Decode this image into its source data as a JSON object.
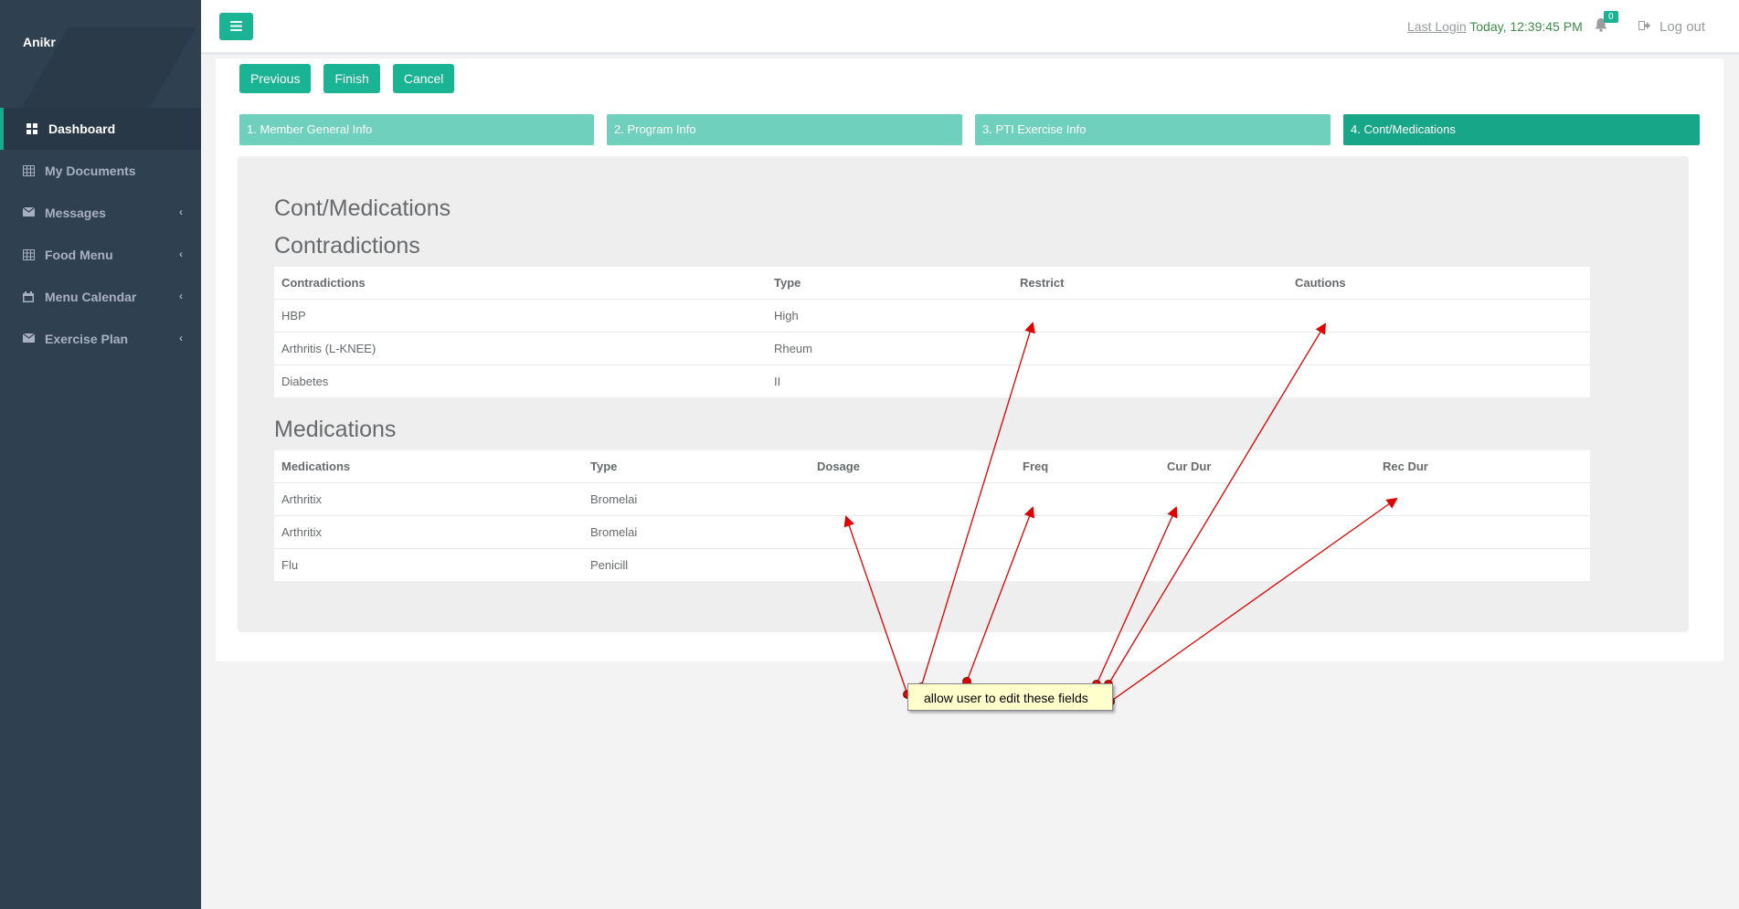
{
  "sidebar": {
    "user_name": "Anikr",
    "items": [
      {
        "label": "Dashboard",
        "icon": "dashboard-icon"
      },
      {
        "label": "My Documents",
        "icon": "table-icon"
      },
      {
        "label": "Messages",
        "icon": "envelope-icon"
      },
      {
        "label": "Food Menu",
        "icon": "table-icon"
      },
      {
        "label": "Menu Calendar",
        "icon": "calendar-icon"
      },
      {
        "label": "Exercise Plan",
        "icon": "envelope-icon"
      }
    ]
  },
  "topbar": {
    "last_login_label": "Last Login",
    "last_login_value": "Today, 12:39:45 PM",
    "notification_count": "0",
    "logout_label": "Log out"
  },
  "wizard": {
    "buttons": {
      "previous": "Previous",
      "finish": "Finish",
      "cancel": "Cancel"
    },
    "steps": [
      "1. Member General Info",
      "2. Program Info",
      "3. PTI Exercise Info",
      "4. Cont/Medications"
    ],
    "current_step": 4,
    "page_title": "Cont/Medications",
    "contradictions": {
      "title": "Contradictions",
      "headers": [
        "Contradictions",
        "Type",
        "Restrict",
        "Cautions"
      ],
      "rows": [
        [
          "HBP",
          "High",
          "",
          ""
        ],
        [
          "Arthritis (L-KNEE)",
          "Rheum",
          "",
          ""
        ],
        [
          "Diabetes",
          "II",
          "",
          ""
        ]
      ]
    },
    "medications": {
      "title": "Medications",
      "headers": [
        "Medications",
        "Type",
        "Dosage",
        "Freq",
        "Cur Dur",
        "Rec Dur"
      ],
      "rows": [
        [
          "Arthritix",
          "Bromelai",
          "",
          "",
          "",
          ""
        ],
        [
          "Arthritix",
          "Bromelai",
          "",
          "",
          "",
          ""
        ],
        [
          "Flu",
          "Penicill",
          "",
          "",
          "",
          ""
        ]
      ]
    }
  },
  "annotation": {
    "note": "allow user to edit these fields"
  },
  "colors": {
    "accent": "#1ab394",
    "sidebar": "#2f4050",
    "step_light": "#6fd1bd",
    "arrow": "#e00000"
  }
}
